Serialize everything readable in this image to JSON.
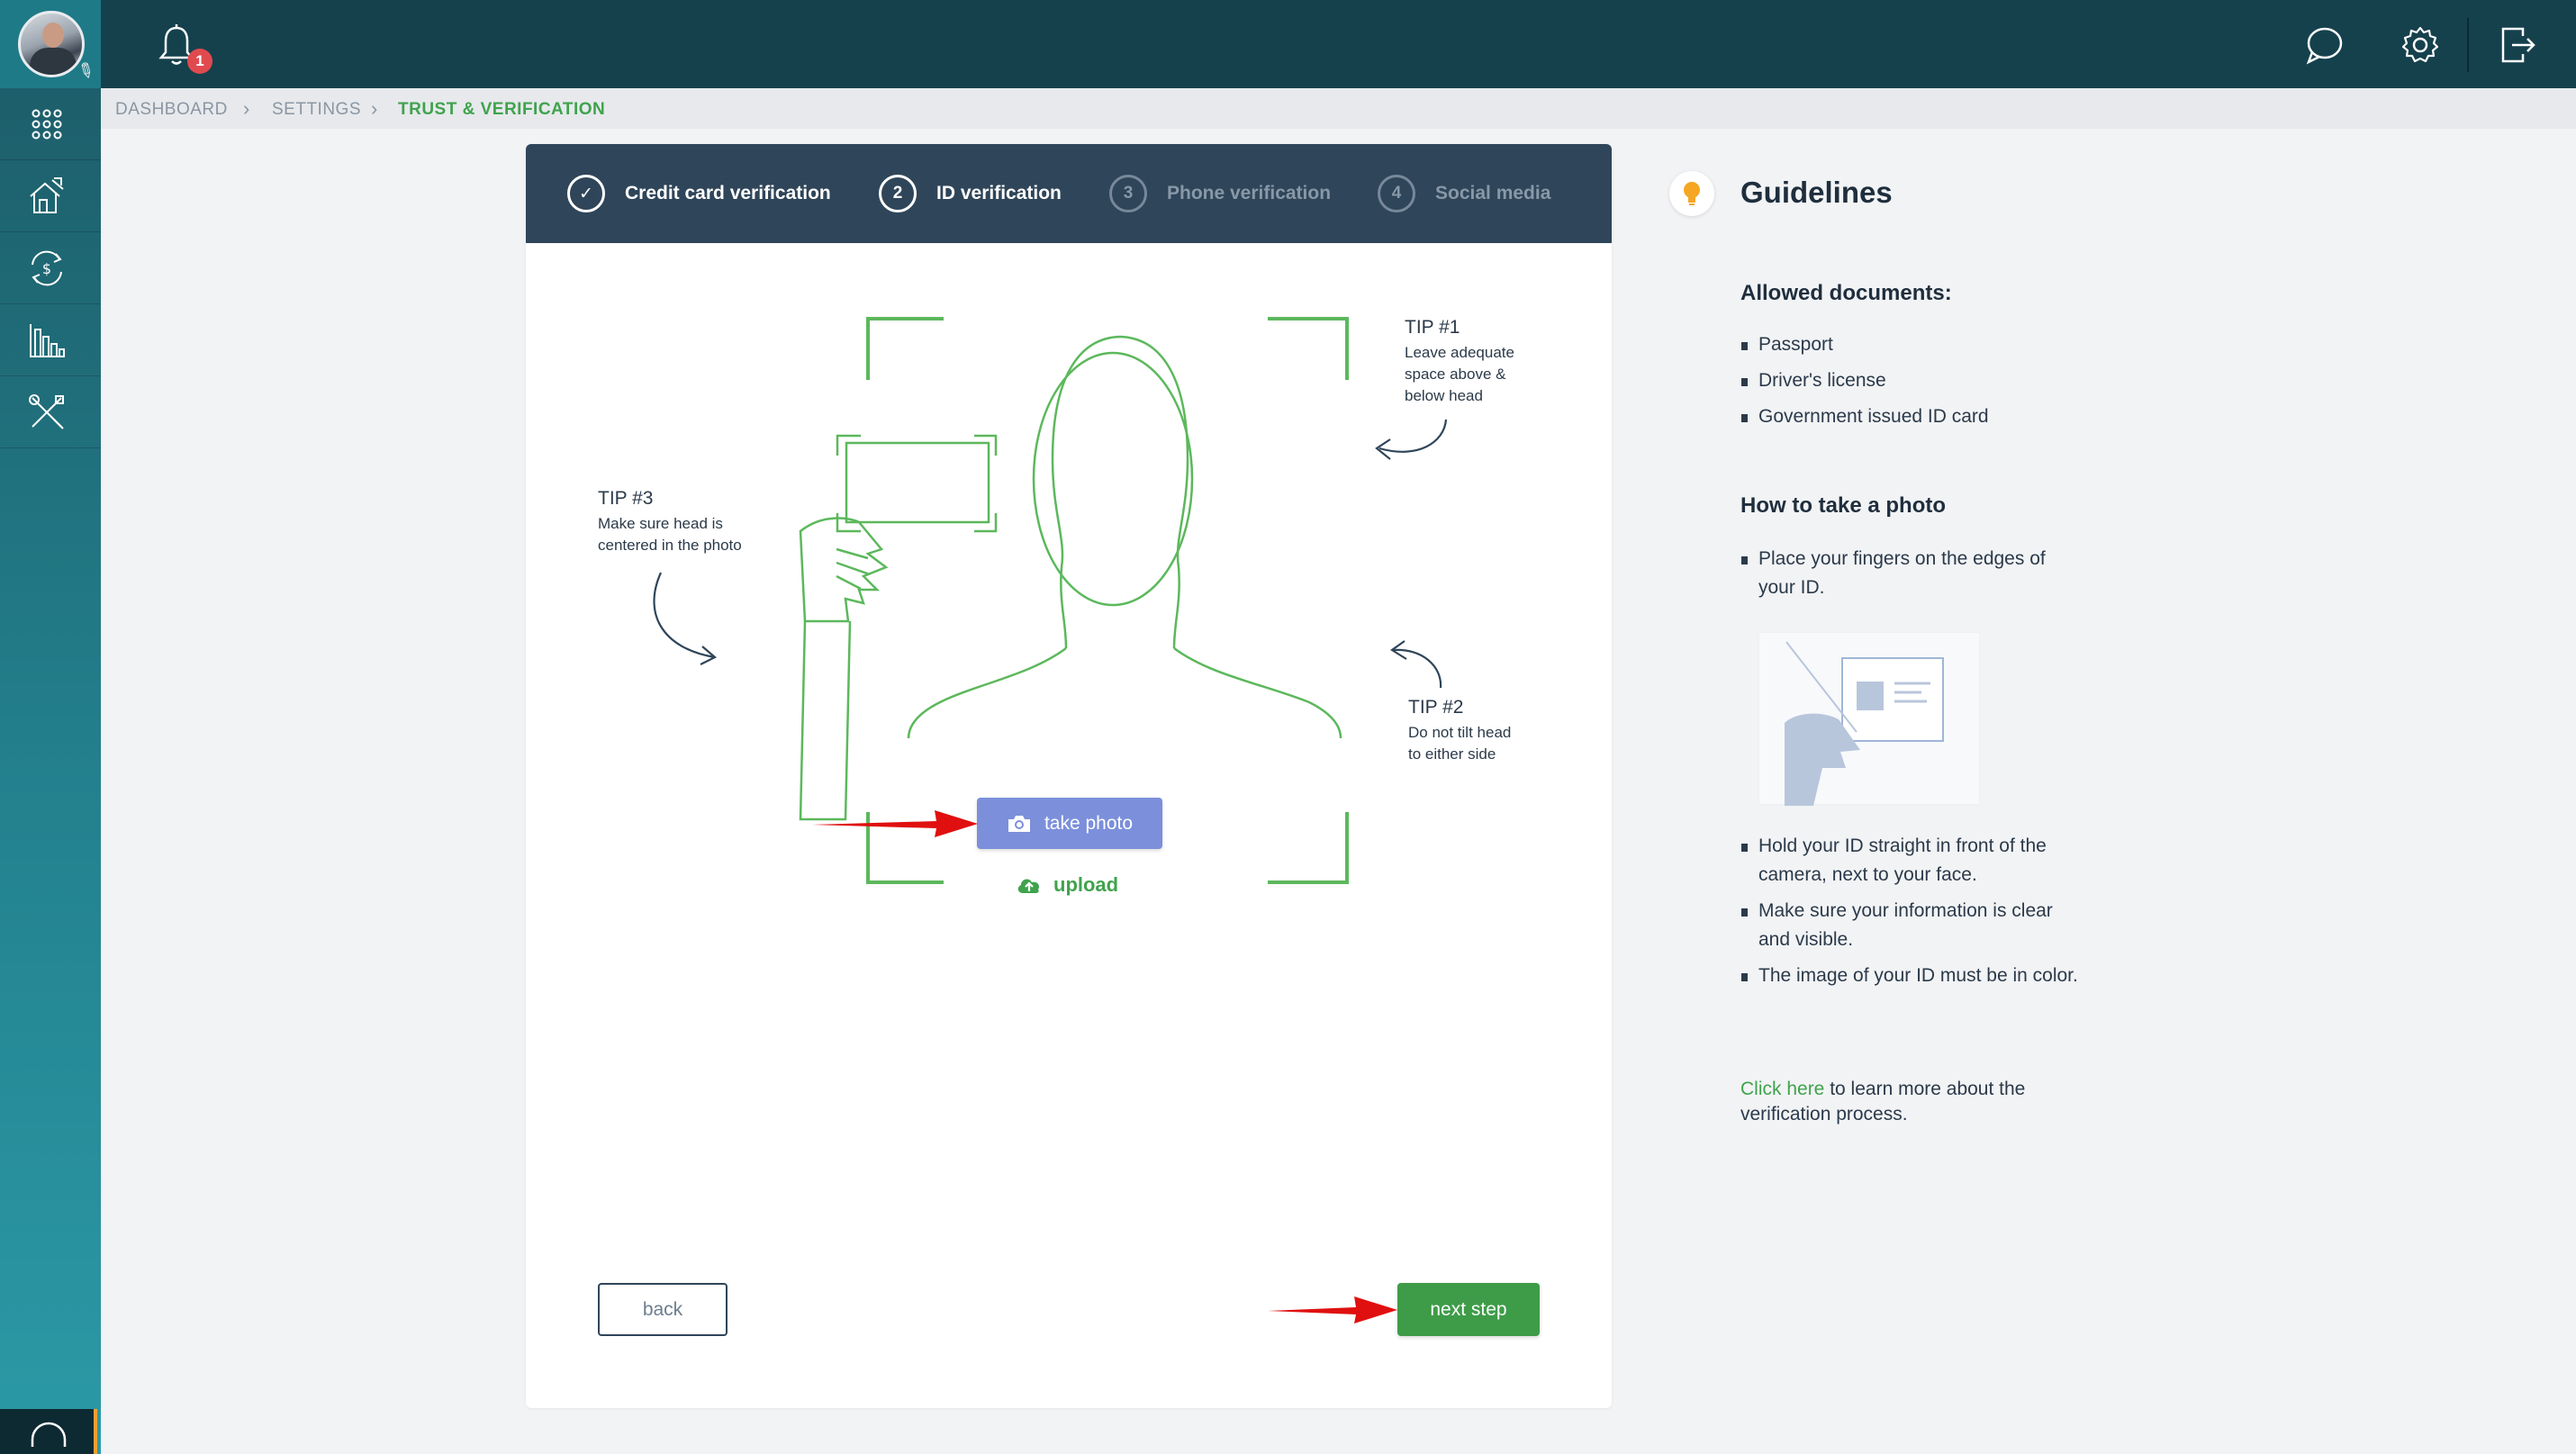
{
  "header": {
    "notifications_count": "1",
    "icons": [
      "bell-icon",
      "chat-icon",
      "gear-icon",
      "logout-icon"
    ]
  },
  "sidebar": {
    "items": [
      {
        "name": "apps-grid-icon"
      },
      {
        "name": "house-icon"
      },
      {
        "name": "money-exchange-icon"
      },
      {
        "name": "bar-chart-icon"
      },
      {
        "name": "tools-icon"
      }
    ]
  },
  "breadcrumb": {
    "items": [
      "DASHBOARD",
      "SETTINGS",
      "TRUST & VERIFICATION"
    ]
  },
  "steps": [
    {
      "number": "✓",
      "label": "Credit card verification"
    },
    {
      "number": "2",
      "label": "ID verification"
    },
    {
      "number": "3",
      "label": "Phone verification"
    },
    {
      "number": "4",
      "label": "Social media"
    }
  ],
  "tips": {
    "tip1_title": "TIP #1",
    "tip1_text": [
      "Leave adequate",
      "space above &",
      "below head"
    ],
    "tip2_title": "TIP #2",
    "tip2_text": [
      "Do not tilt head",
      "to either side"
    ],
    "tip3_title": "TIP #3",
    "tip3_text": [
      "Make sure head is",
      "centered in the photo"
    ]
  },
  "actions": {
    "take_photo": "take photo",
    "upload": "upload",
    "back": "back",
    "next_step": "next step"
  },
  "guidelines": {
    "title": "Guidelines",
    "allowed_heading": "Allowed documents:",
    "allowed": [
      "Passport",
      "Driver's license",
      "Government issued ID card"
    ],
    "howto_heading": "How to take a photo",
    "howto_1": "Place your fingers on the edges of your ID.",
    "howto_rest": [
      "Hold your ID straight in front of the camera, next to your face.",
      "Make sure your information is clear and visible.",
      "The image of your ID must be in color."
    ],
    "footer_link": "Click here",
    "footer_text": " to learn more about the verification process."
  },
  "colors": {
    "topbar": "#15414d",
    "accent_green": "#3fa34d",
    "take_photo_button": "#7b8fdb",
    "steps_header": "#2f4559",
    "badge_red": "#e04a4f"
  }
}
